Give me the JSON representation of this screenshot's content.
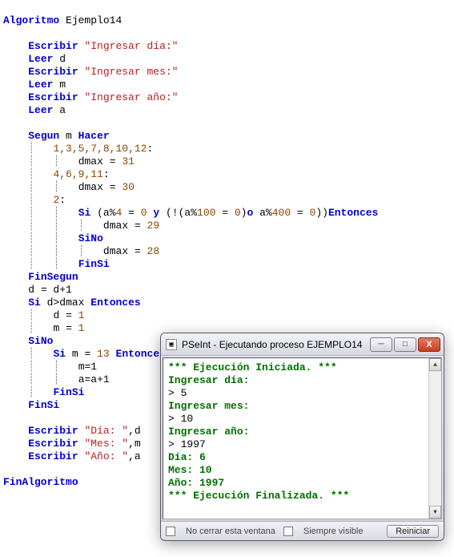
{
  "code": {
    "algoritmo": "Algoritmo",
    "name": "Ejemplo14",
    "escribir": "Escribir",
    "leer": "Leer",
    "segun": "Segun",
    "hacer": "Hacer",
    "finsegun": "FinSegun",
    "si": "Si",
    "entonces": "Entonces",
    "sino": "SiNo",
    "finsi": "FinSi",
    "finalgoritmo": "FinAlgoritmo",
    "y": "y",
    "o": "o",
    "str_dia": "\"Ingresar día:\"",
    "str_mes": "\"Ingresar mes:\"",
    "str_ano": "\"Ingresar año:\"",
    "str_out_dia": "\"Día: \"",
    "str_out_mes": "\"Mes: \"",
    "str_out_ano": "\"Año: \"",
    "var_d": "d",
    "var_m": "m",
    "var_a": "a",
    "var_dmax": "dmax",
    "case1": "1,3,5,7,8,10,12",
    "case2": "4,6,9,11",
    "case3": "2",
    "n31": "31",
    "n30": "30",
    "n29": "29",
    "n28": "28",
    "n4": "4",
    "n100": "100",
    "n400": "400",
    "n0": "0",
    "n1": "1",
    "n13": "13",
    "dplus": "d = d+1",
    "aplus": "a=a+1",
    "mset": "m=1"
  },
  "console": {
    "title": "PSeInt - Ejecutando proceso EJEMPLO14",
    "lines": {
      "start": "*** Ejecución Iniciada. ***",
      "p1": "Ingresar día:",
      "i1": "> 5",
      "p2": "Ingresar mes:",
      "i2": "> 10",
      "p3": "Ingresar año:",
      "i3": "> 1997",
      "o1": "Día: 6",
      "o2": "Mes: 10",
      "o3": "Año: 1997",
      "end": "*** Ejecución Finalizada. ***"
    },
    "status": {
      "chk1": "No cerrar esta ventana",
      "chk2": "Siempre visible",
      "btn": "Reiniciar"
    }
  }
}
